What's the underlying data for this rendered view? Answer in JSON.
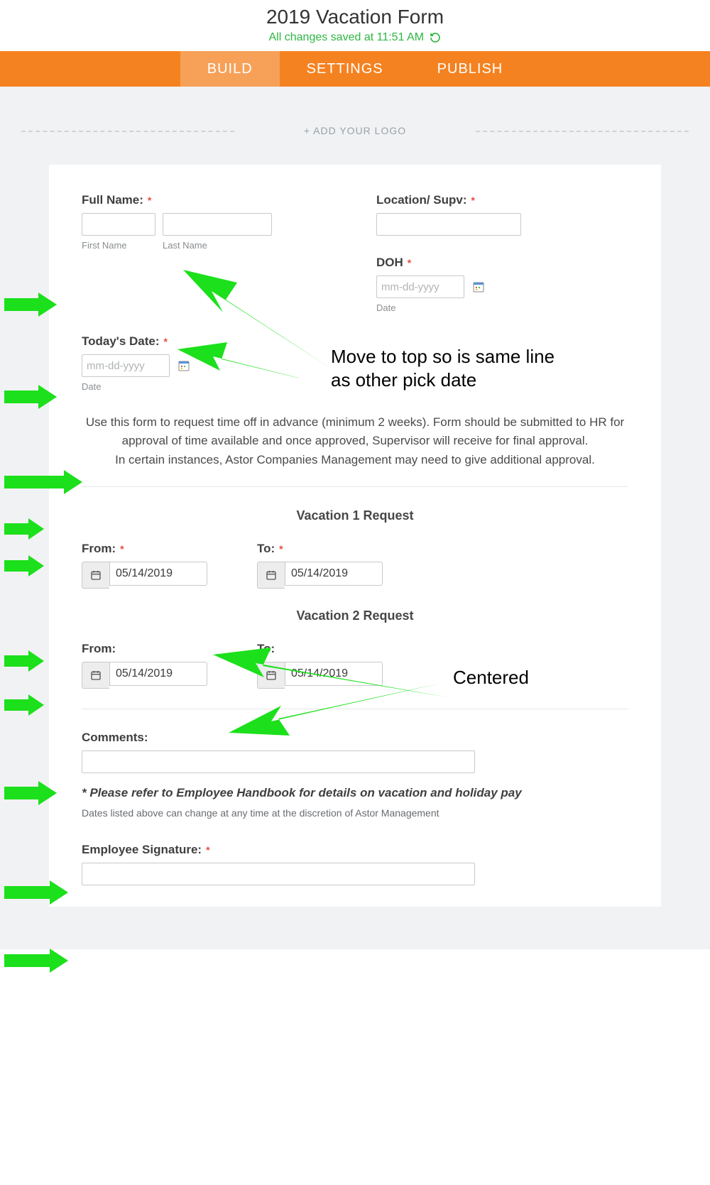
{
  "header": {
    "title": "2019 Vacation Form",
    "save_status": "All changes saved at 11:51 AM"
  },
  "tabs": {
    "build": "BUILD",
    "settings": "SETTINGS",
    "publish": "PUBLISH"
  },
  "logo_hint": "+ ADD YOUR LOGO",
  "labels": {
    "full_name": "Full Name:",
    "first_name": "First Name",
    "last_name": "Last Name",
    "location_supv": "Location/ Supv:",
    "doh": "DOH",
    "date_sub": "Date",
    "todays_date": "Today's Date:",
    "from": "From:",
    "to": "To:",
    "comments": "Comments:",
    "employee_signature": "Employee Signature:"
  },
  "placeholders": {
    "date": "mm-dd-yyyy"
  },
  "description": {
    "line1": "Use this form to request time off in advance (minimum 2 weeks). Form should be submitted to HR for approval of time available and once approved, Supervisor will receive for final approval.",
    "line2": "In certain instances, Astor Companies Management may need to give additional approval."
  },
  "sections": {
    "vac1": "Vacation 1 Request",
    "vac2": "Vacation 2 Request"
  },
  "dates": {
    "vac1_from": "05/14/2019",
    "vac1_to": "05/14/2019",
    "vac2_from": "05/14/2019",
    "vac2_to": "05/14/2019"
  },
  "notes": {
    "handbook": "* Please refer to Employee Handbook for details on vacation and holiday pay",
    "discretion": "Dates listed above can change at any time at the discretion of Astor Management"
  },
  "annotations": {
    "move_top": "Move to top so is same line as other pick date",
    "centered": "Centered"
  },
  "colors": {
    "brand": "#f58220",
    "arrow": "#1be01b"
  }
}
